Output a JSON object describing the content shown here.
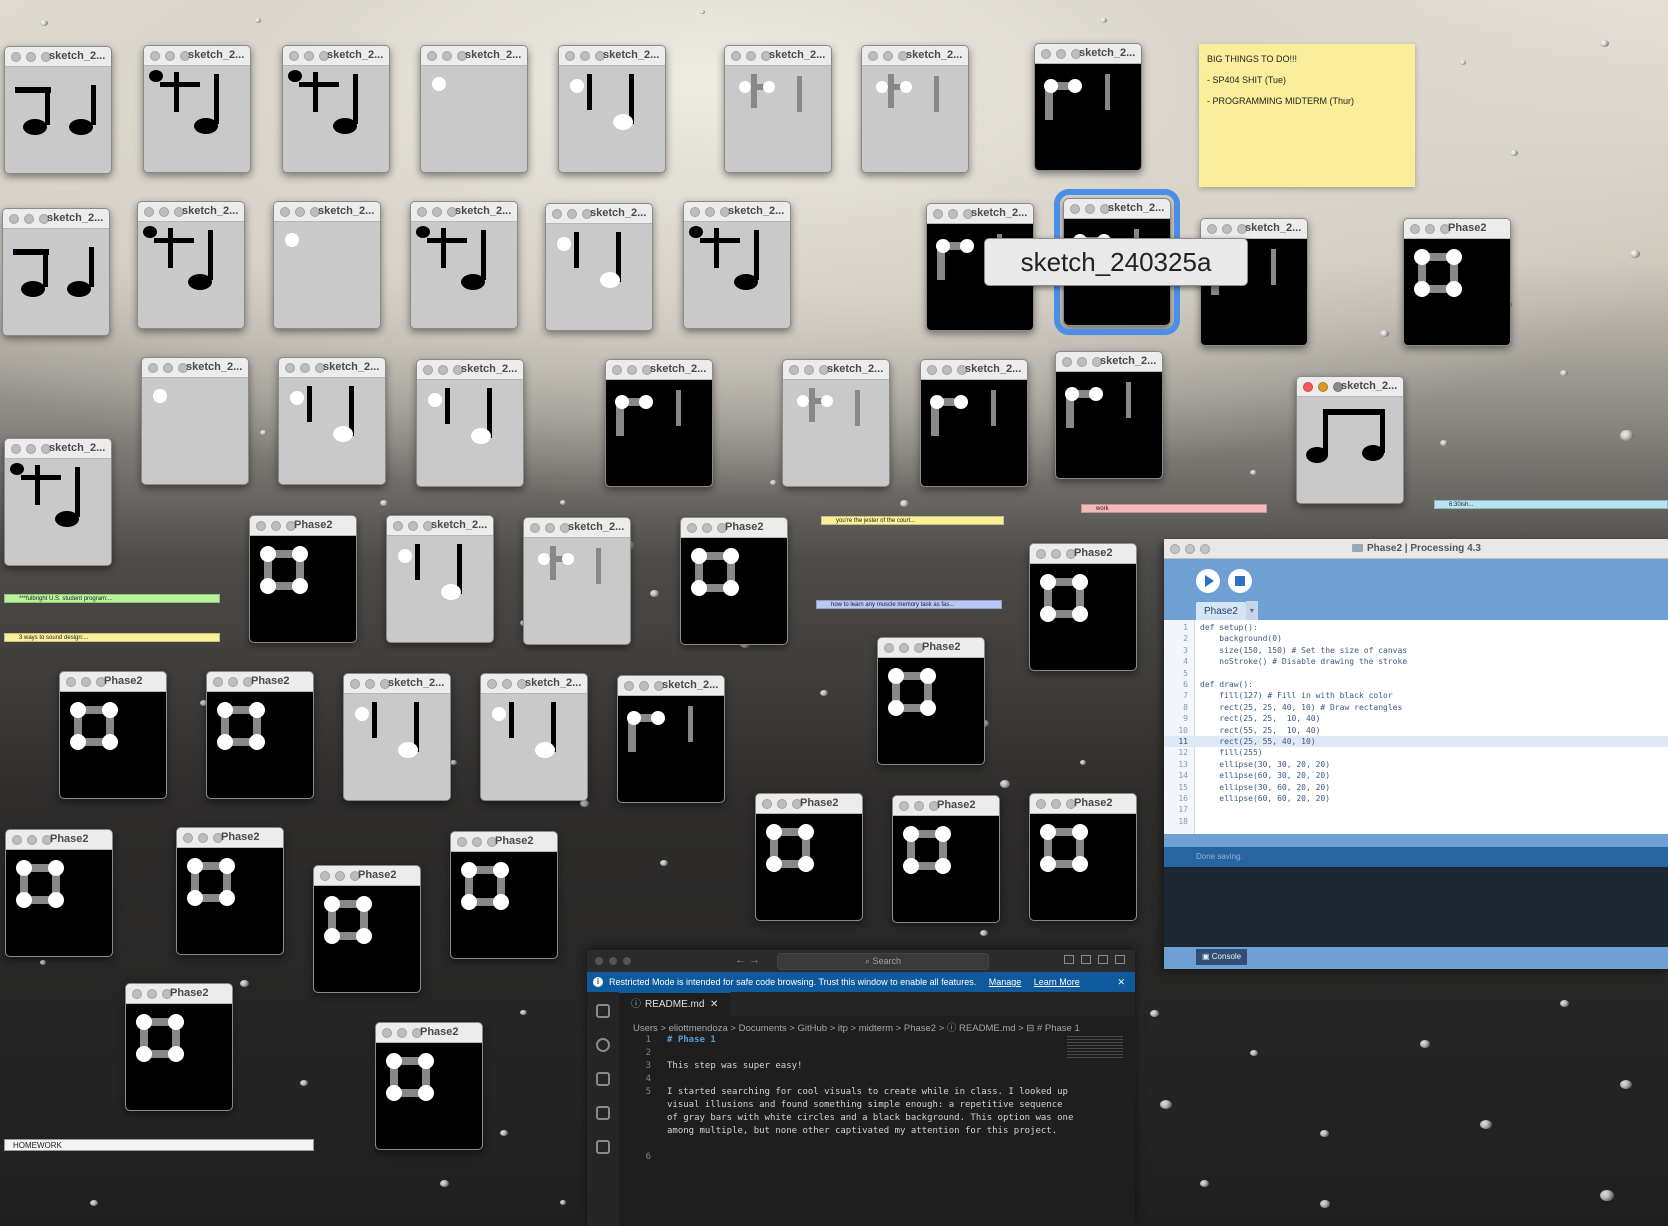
{
  "colors": {
    "accent_selection": "#4a8ee8",
    "sticky_yellow": "#fbee9a",
    "processing_blue": "#6ea0d4",
    "vscode_banner": "#0e5a9c"
  },
  "sketch_windows": [
    {
      "title": "sketch_2...",
      "icon": "quarter-note-pair-icon"
    },
    {
      "title": "sketch_2...",
      "icon": "music-note-cross-icon"
    },
    {
      "title": "sketch_2...",
      "icon": "music-note-cross-icon"
    },
    {
      "title": "sketch_2...",
      "icon": "white-dot-icon"
    },
    {
      "title": "sketch_2...",
      "icon": "bars-dots-icon"
    },
    {
      "title": "sketch_2...",
      "icon": "gray-cross-icon"
    },
    {
      "title": "sketch_2...",
      "icon": "gray-cross-icon"
    },
    {
      "title": "sketch_2...",
      "icon": "gray-corner-icon"
    },
    {
      "title": "Phase2",
      "icon": "white-square-grid-icon"
    }
  ],
  "selected_window": {
    "tooltip": "sketch_240325a",
    "title": "sketch_2..."
  },
  "music_window": {
    "title": "sketch_2..."
  },
  "sticky_note": {
    "line1": "BIG THINGS TO DO!!!",
    "line2": "- SP404 SHIT (Tue)",
    "line3": "- PROGRAMMING MIDTERM (Thur)"
  },
  "tags": {
    "jester": "you're the jester of the court...",
    "muscle": "how to learn any muscle memory task as fas...",
    "work": "work",
    "time": "6:30ish...",
    "fulbright": "***fulbright U.S. student program:...",
    "sound": "3 ways to sound design:...",
    "homework": "HOMEWORK"
  },
  "processing": {
    "title": "Phase2 | Processing 4.3",
    "tab": "Phase2",
    "tab_menu": "▾",
    "status": "Done saving.",
    "console_button": "Console",
    "code": [
      "def setup():",
      "    background(0)",
      "    size(150, 150) # Set the size of canvas",
      "    noStroke() # Disable drawing the stroke",
      "",
      "def draw():",
      "    fill(127) # Fill in with black color",
      "    rect(25, 25, 40, 10) # Draw rectangles",
      "    rect(25, 25,  10, 40)",
      "    rect(55, 25,  10, 40)",
      "    rect(25, 55, 40, 10)",
      "    fill(255)",
      "    ellipse(30, 30, 20, 20)",
      "    ellipse(60, 30, 20, 20)",
      "    ellipse(30, 60, 20, 20)",
      "    ellipse(60, 60, 20, 20)",
      "",
      ""
    ],
    "highlighted_line": 11
  },
  "vscode": {
    "search_placeholder": "Search",
    "nav": "←  →",
    "banner_text": "Restricted Mode is intended for safe code browsing. Trust this window to enable all features.",
    "banner_manage": "Manage",
    "banner_learn": "Learn More",
    "banner_close": "✕",
    "tab_label": "README.md",
    "tab_close": "✕",
    "breadcrumb": "Users  >  eliottmendoza  >  Documents  >  GitHub  >  itp  >  midterm  >  Phase2  >  ⓘ README.md  >  ⊟ # Phase 1",
    "lines": [
      {
        "n": "1",
        "text": "# Phase 1",
        "heading": true
      },
      {
        "n": "2",
        "text": ""
      },
      {
        "n": "3",
        "text": "This step was super easy!"
      },
      {
        "n": "4",
        "text": ""
      },
      {
        "n": "5",
        "text": "I started searching for cool visuals to create while in class. I looked up"
      },
      {
        "n": "",
        "text": "visual illusions and found something simple enough: a repetitive sequence"
      },
      {
        "n": "",
        "text": "of gray bars with white circles and a black background. This option was one"
      },
      {
        "n": "",
        "text": "among multiple, but none other captivated my attention for this project."
      },
      {
        "n": "",
        "text": ""
      },
      {
        "n": "6",
        "text": ""
      }
    ]
  }
}
